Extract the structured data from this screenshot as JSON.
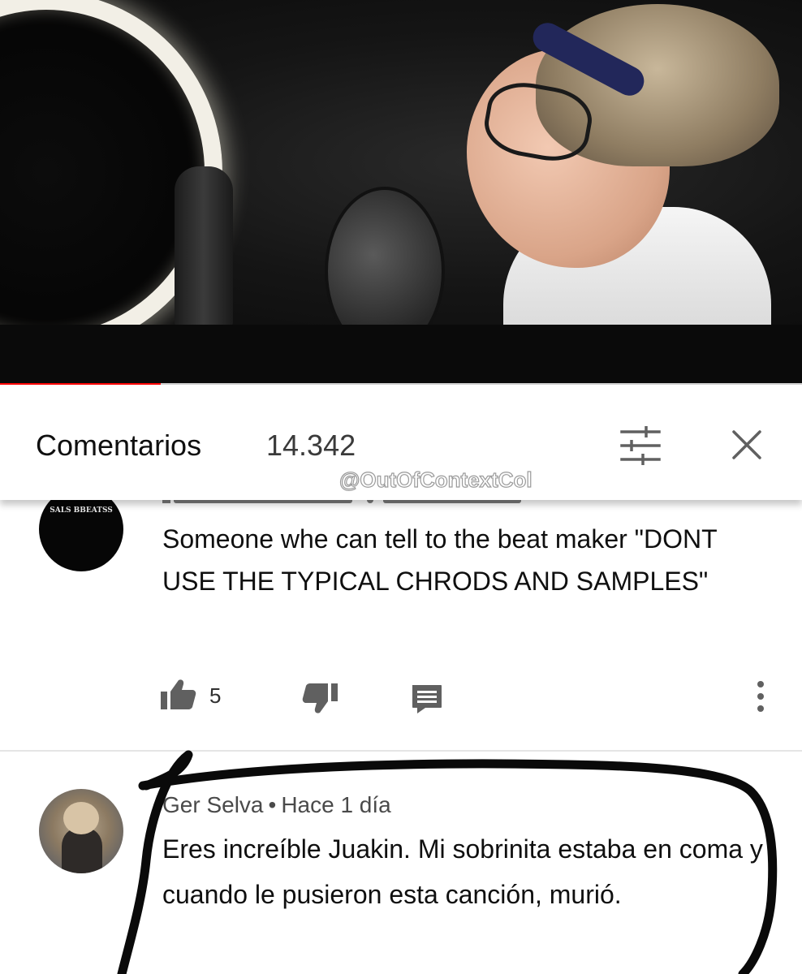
{
  "video": {
    "progress_fraction": 0.2,
    "progress_color": "#ff0000"
  },
  "comments_header": {
    "title": "Comentarios",
    "count": "14.342",
    "sort_icon": "sort-filter-icon",
    "close_icon": "close-icon",
    "watermark": "@OutOfContextCol"
  },
  "comments": [
    {
      "avatar_text": "SALS BBEATSS",
      "text": "Someone whe can tell to the beat maker \"DONT USE THE TYPICAL CHRODS AND SAMPLES\"",
      "likes": "5",
      "actions": {
        "like_icon": "thumbs-up-icon",
        "dislike_icon": "thumbs-down-icon",
        "reply_icon": "reply-icon",
        "more_icon": "more-vertical-icon"
      }
    },
    {
      "author": "Ger Selva",
      "separator": "•",
      "time": "Hace 1 día",
      "text": "Eres increíble Juakin. Mi sobrinita estaba en coma y cuando le pusieron esta canción, murió."
    }
  ],
  "colors": {
    "marker": "#0a0a0a",
    "divider": "#e5e5e5"
  }
}
